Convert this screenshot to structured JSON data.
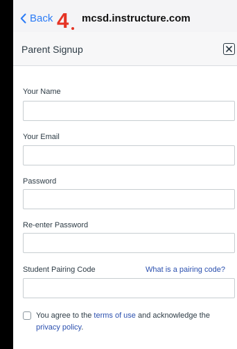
{
  "browser": {
    "back_label": "Back",
    "step_number": "4",
    "domain": "mcsd.instructure.com"
  },
  "dialog": {
    "title": "Parent Signup"
  },
  "form": {
    "name_label": "Your Name",
    "email_label": "Your Email",
    "password_label": "Password",
    "reenter_label": "Re-enter Password",
    "pairing_label": "Student Pairing Code",
    "pairing_help_link": "What is a pairing code?",
    "agree_prefix": "You agree to the ",
    "terms_link": "terms of use",
    "agree_middle": " and acknowledge the ",
    "privacy_link": "privacy policy",
    "agree_suffix": "."
  },
  "icons": {
    "back": "chevron-left-icon",
    "close": "close-icon"
  },
  "colors": {
    "accent_blue": "#2c7cf6",
    "link_blue": "#2a4fae",
    "step_red": "#e53425"
  }
}
